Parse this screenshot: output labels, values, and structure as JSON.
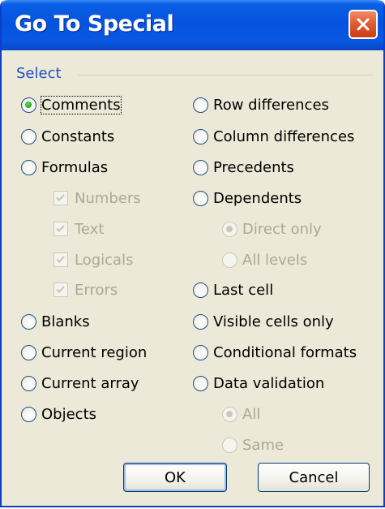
{
  "dialog": {
    "title": "Go To Special"
  },
  "group": {
    "label": "Select"
  },
  "left": [
    {
      "label": "Comments",
      "type": "radio",
      "checked": true,
      "disabled": false
    },
    {
      "label": "Constants",
      "type": "radio",
      "checked": false,
      "disabled": false
    },
    {
      "label": "Formulas",
      "type": "radio",
      "checked": false,
      "disabled": false
    },
    {
      "label": "Numbers",
      "type": "check",
      "checked": true,
      "disabled": true
    },
    {
      "label": "Text",
      "type": "check",
      "checked": true,
      "disabled": true
    },
    {
      "label": "Logicals",
      "type": "check",
      "checked": true,
      "disabled": true
    },
    {
      "label": "Errors",
      "type": "check",
      "checked": true,
      "disabled": true
    },
    {
      "label": "Blanks",
      "type": "radio",
      "checked": false,
      "disabled": false
    },
    {
      "label": "Current region",
      "type": "radio",
      "checked": false,
      "disabled": false
    },
    {
      "label": "Current array",
      "type": "radio",
      "checked": false,
      "disabled": false
    },
    {
      "label": "Objects",
      "type": "radio",
      "checked": false,
      "disabled": false
    }
  ],
  "right": [
    {
      "label": "Row differences",
      "type": "radio",
      "checked": false,
      "disabled": false
    },
    {
      "label": "Column differences",
      "type": "radio",
      "checked": false,
      "disabled": false
    },
    {
      "label": "Precedents",
      "type": "radio",
      "checked": false,
      "disabled": false
    },
    {
      "label": "Dependents",
      "type": "radio",
      "checked": false,
      "disabled": false
    },
    {
      "label": "Direct only",
      "type": "radio",
      "checked": true,
      "disabled": true
    },
    {
      "label": "All levels",
      "type": "radio",
      "checked": false,
      "disabled": true
    },
    {
      "label": "Last cell",
      "type": "radio",
      "checked": false,
      "disabled": false
    },
    {
      "label": "Visible cells only",
      "type": "radio",
      "checked": false,
      "disabled": false
    },
    {
      "label": "Conditional formats",
      "type": "radio",
      "checked": false,
      "disabled": false
    },
    {
      "label": "Data validation",
      "type": "radio",
      "checked": false,
      "disabled": false
    },
    {
      "label": "All",
      "type": "radio",
      "checked": true,
      "disabled": true
    },
    {
      "label": "Same",
      "type": "radio",
      "checked": false,
      "disabled": true
    }
  ],
  "buttons": {
    "ok": "OK",
    "cancel": "Cancel"
  },
  "colors": {
    "title_bar": "#0553de",
    "group_label": "#1e4fc2",
    "dialog_bg": "#ece9d8",
    "close_button": "#e05a30"
  }
}
